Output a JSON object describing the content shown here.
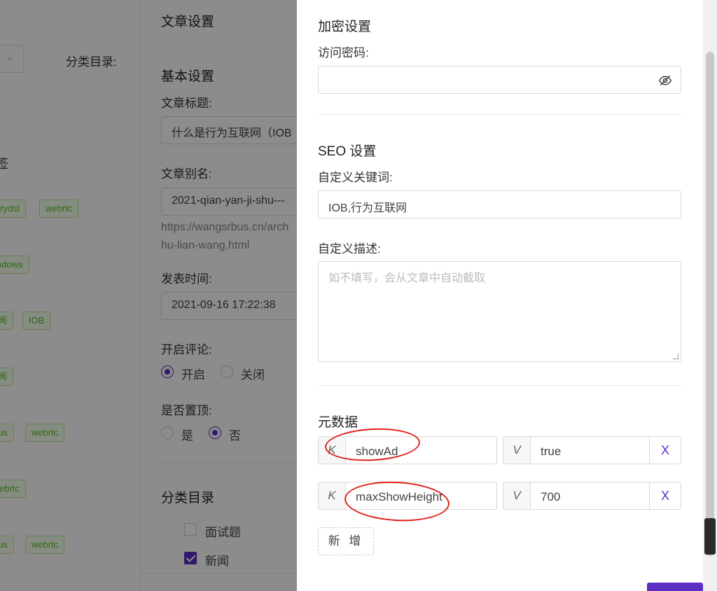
{
  "background": {
    "category_label": "分类目录:",
    "section_label_fragment": "签",
    "rows": [
      {
        "tags": [
          "erydsl",
          "webrtc"
        ]
      },
      {
        "tags": [
          "ndows"
        ]
      },
      {
        "tags": [
          "闻",
          "IOB"
        ]
      },
      {
        "tags": [
          "闻"
        ]
      },
      {
        "tags": [
          "us",
          "webrtc"
        ]
      },
      {
        "tags": [
          "ebrtc"
        ]
      },
      {
        "tags": [
          "us",
          "webrtc"
        ]
      }
    ]
  },
  "middle_panel": {
    "header": "文章设置",
    "basic_section": "基本设置",
    "title_label": "文章标题:",
    "title_value": "什么是行为互联网（IOB",
    "slug_label": "文章别名:",
    "slug_value": "2021-qian-yan-ji-shu---",
    "url_line1": "https://wangsrbus.cn/arch",
    "url_line2": "hu-lian-wang.html",
    "publish_label": "发表时间:",
    "publish_value": "2021-09-16 17:22:38",
    "comment_label": "开启评论:",
    "comment_on": "开启",
    "comment_off": "关闭",
    "top_label": "是否置顶:",
    "top_yes": "是",
    "top_no": "否",
    "category_section": "分类目录",
    "categories": [
      {
        "label": "面试题",
        "checked": false
      },
      {
        "label": "新闻",
        "checked": true
      }
    ]
  },
  "drawer": {
    "encrypt_title": "加密设置",
    "password_label": "访问密码:",
    "password_value": "",
    "seo_title": "SEO 设置",
    "keywords_label": "自定义关键词:",
    "keywords_value": "IOB,行为互联网",
    "desc_label": "自定义描述:",
    "desc_placeholder": "如不填写，会从文章中自动截取",
    "meta_title": "元数据",
    "meta": [
      {
        "k_prefix": "K",
        "key": "showAd",
        "v_prefix": "V",
        "value": "true",
        "delete": "X"
      },
      {
        "k_prefix": "K",
        "key": "maxShowHeight",
        "v_prefix": "V",
        "value": "700",
        "delete": "X"
      }
    ],
    "add_button": "新 增"
  },
  "colors": {
    "accent": "#5b2ec4",
    "annotation": "#e0201a",
    "tag_green": "#52c41a"
  }
}
